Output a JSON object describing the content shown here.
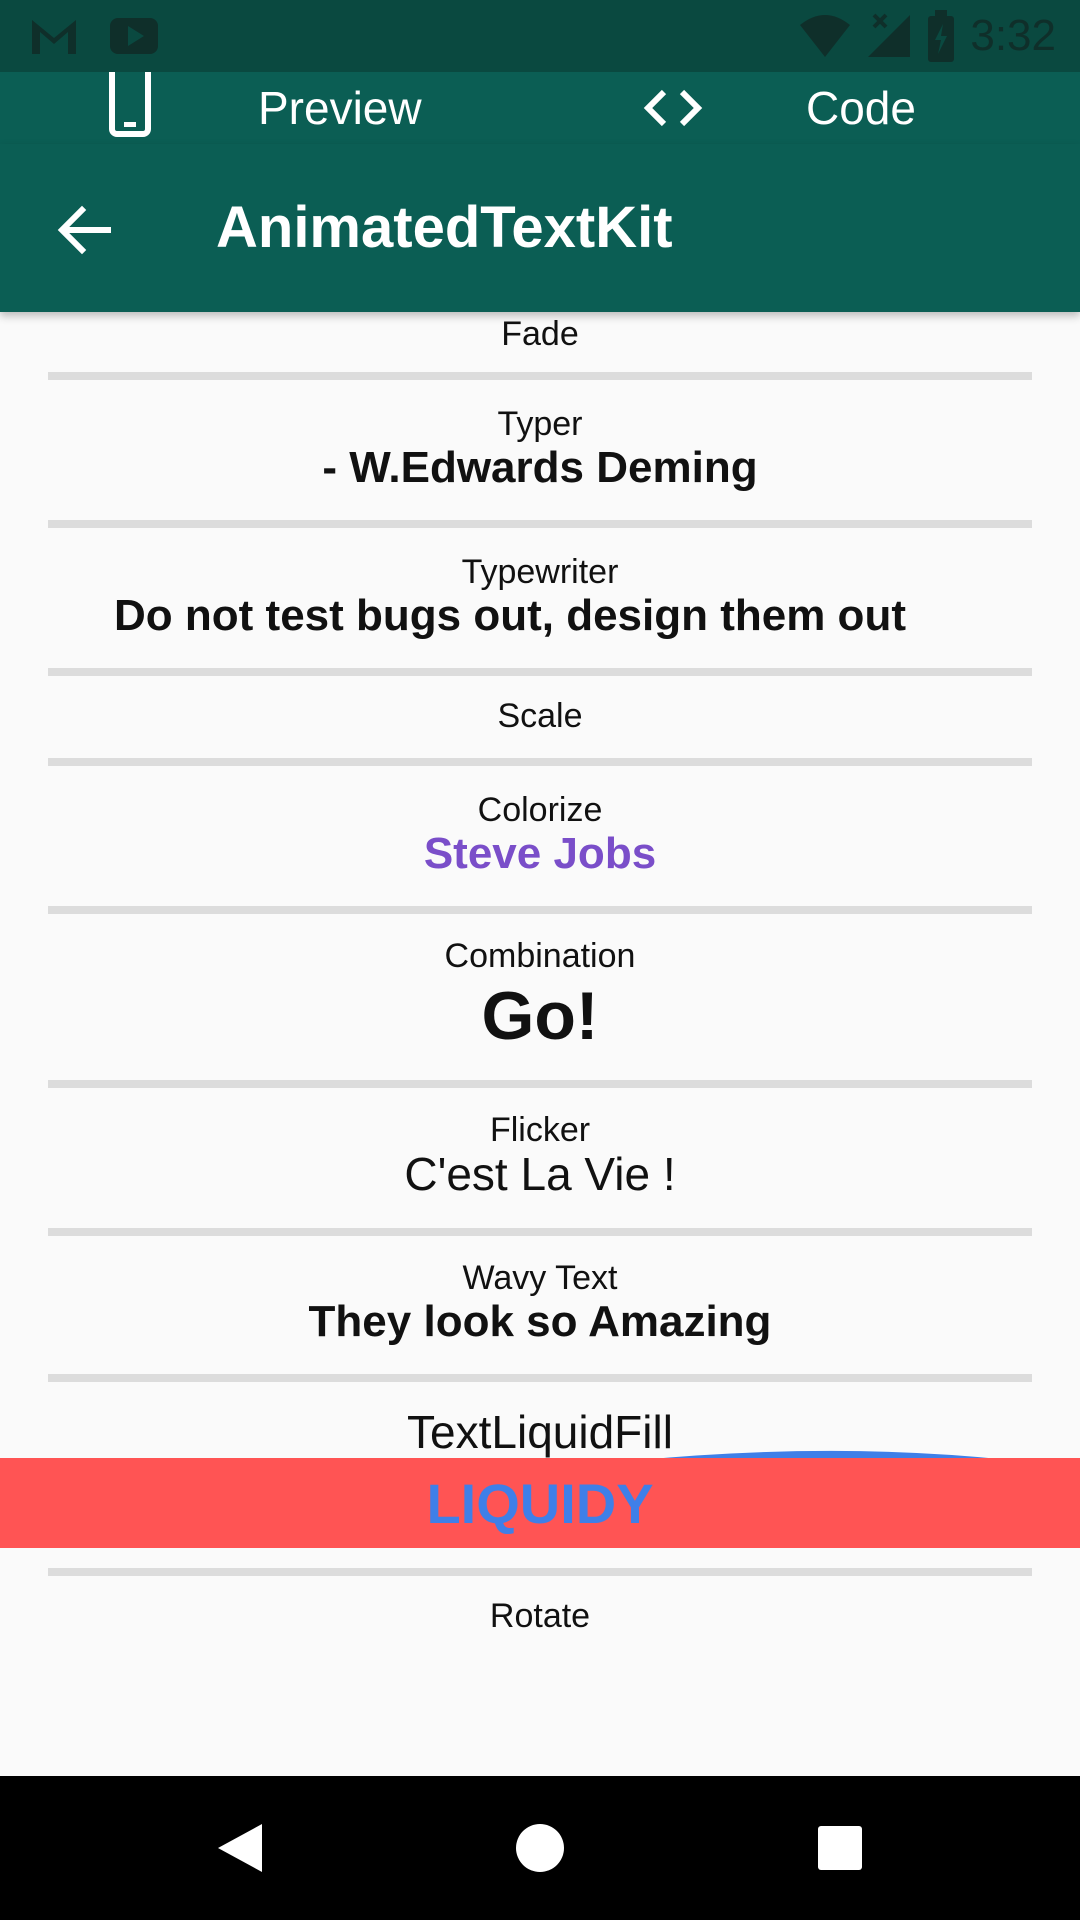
{
  "status_bar": {
    "time": "3:32",
    "left_icons": [
      "gmail-icon",
      "youtube-icon"
    ],
    "right_icons": [
      "wifi-icon",
      "signal-icon",
      "battery-icon"
    ]
  },
  "tabs": [
    {
      "icon": "phone-icon",
      "label": "Preview"
    },
    {
      "icon": "code-icon",
      "label": "Code"
    }
  ],
  "app_bar": {
    "title": "AnimatedTextKit",
    "back_icon": "arrow-back-icon"
  },
  "items": [
    {
      "label": "Fade",
      "value": ""
    },
    {
      "label": "Typer",
      "value": "- W.Edwards Deming"
    },
    {
      "label": "Typewriter",
      "value": "Do not test bugs out, design them out"
    },
    {
      "label": "Scale",
      "value": ""
    },
    {
      "label": "Colorize",
      "value": "Steve Jobs",
      "value_color": "#7a4ec9"
    },
    {
      "label": "Combination",
      "value": "Go!"
    },
    {
      "label": "Flicker",
      "value": "C'est La Vie !"
    },
    {
      "label": "Wavy Text",
      "value": "They look so Amazing"
    },
    {
      "label": "TextLiquidFill",
      "value": "LIQUIDY",
      "band_color": "#ff5454",
      "text_color": "#3f7fe8"
    },
    {
      "label": "Rotate",
      "value": ""
    }
  ],
  "nav_bar": {
    "back": "nav-back-icon",
    "home": "nav-home-icon",
    "recents": "nav-recents-icon"
  },
  "colors": {
    "primary": "#0b5e54",
    "status_bar": "#0a4940",
    "background": "#fafafa",
    "divider": "#dcdcdc"
  }
}
